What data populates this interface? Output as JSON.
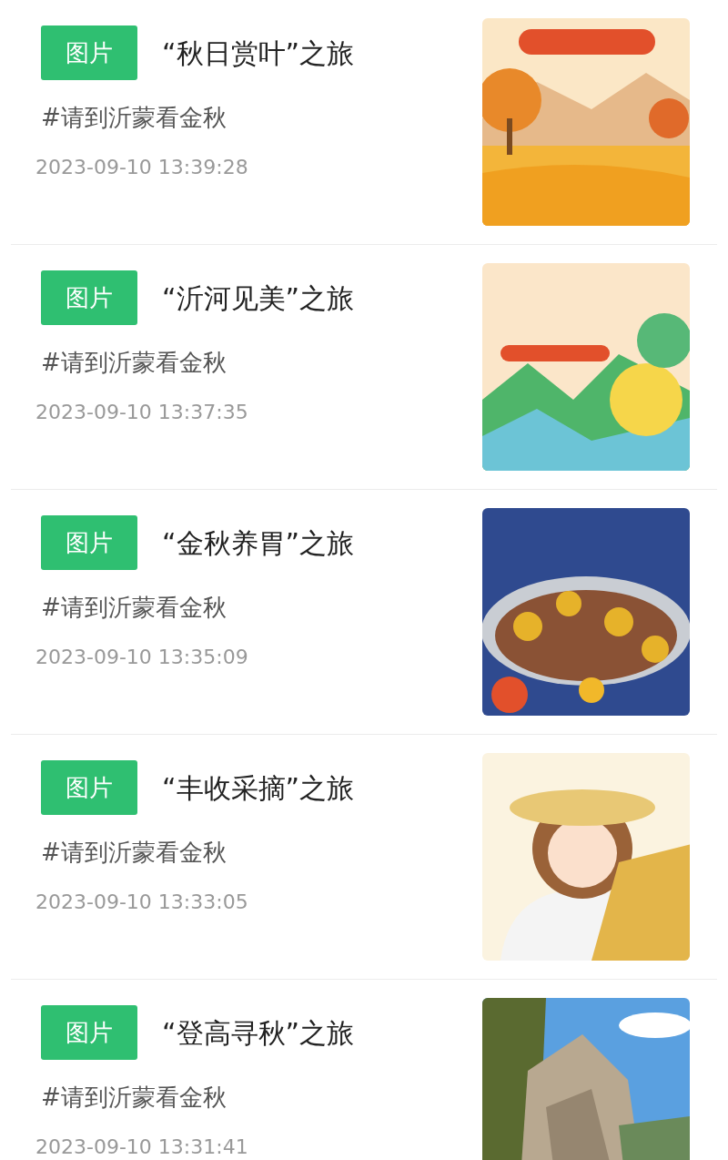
{
  "posts": [
    {
      "badge": "图片",
      "title": "“秋日赏叶”之旅",
      "hashtag": "#请到沂蒙看金秋",
      "time": "2023-09-10 13:39:28"
    },
    {
      "badge": "图片",
      "title": "“沂河见美”之旅",
      "hashtag": "#请到沂蒙看金秋",
      "time": "2023-09-10 13:37:35"
    },
    {
      "badge": "图片",
      "title": "“金秋养胃”之旅",
      "hashtag": "#请到沂蒙看金秋",
      "time": "2023-09-10 13:35:09"
    },
    {
      "badge": "图片",
      "title": "“丰收采摘”之旅",
      "hashtag": "#请到沂蒙看金秋",
      "time": "2023-09-10 13:33:05"
    },
    {
      "badge": "图片",
      "title": "“登高寻秋”之旅",
      "hashtag": "#请到沂蒙看金秋",
      "time": "2023-09-10 13:31:41"
    }
  ]
}
